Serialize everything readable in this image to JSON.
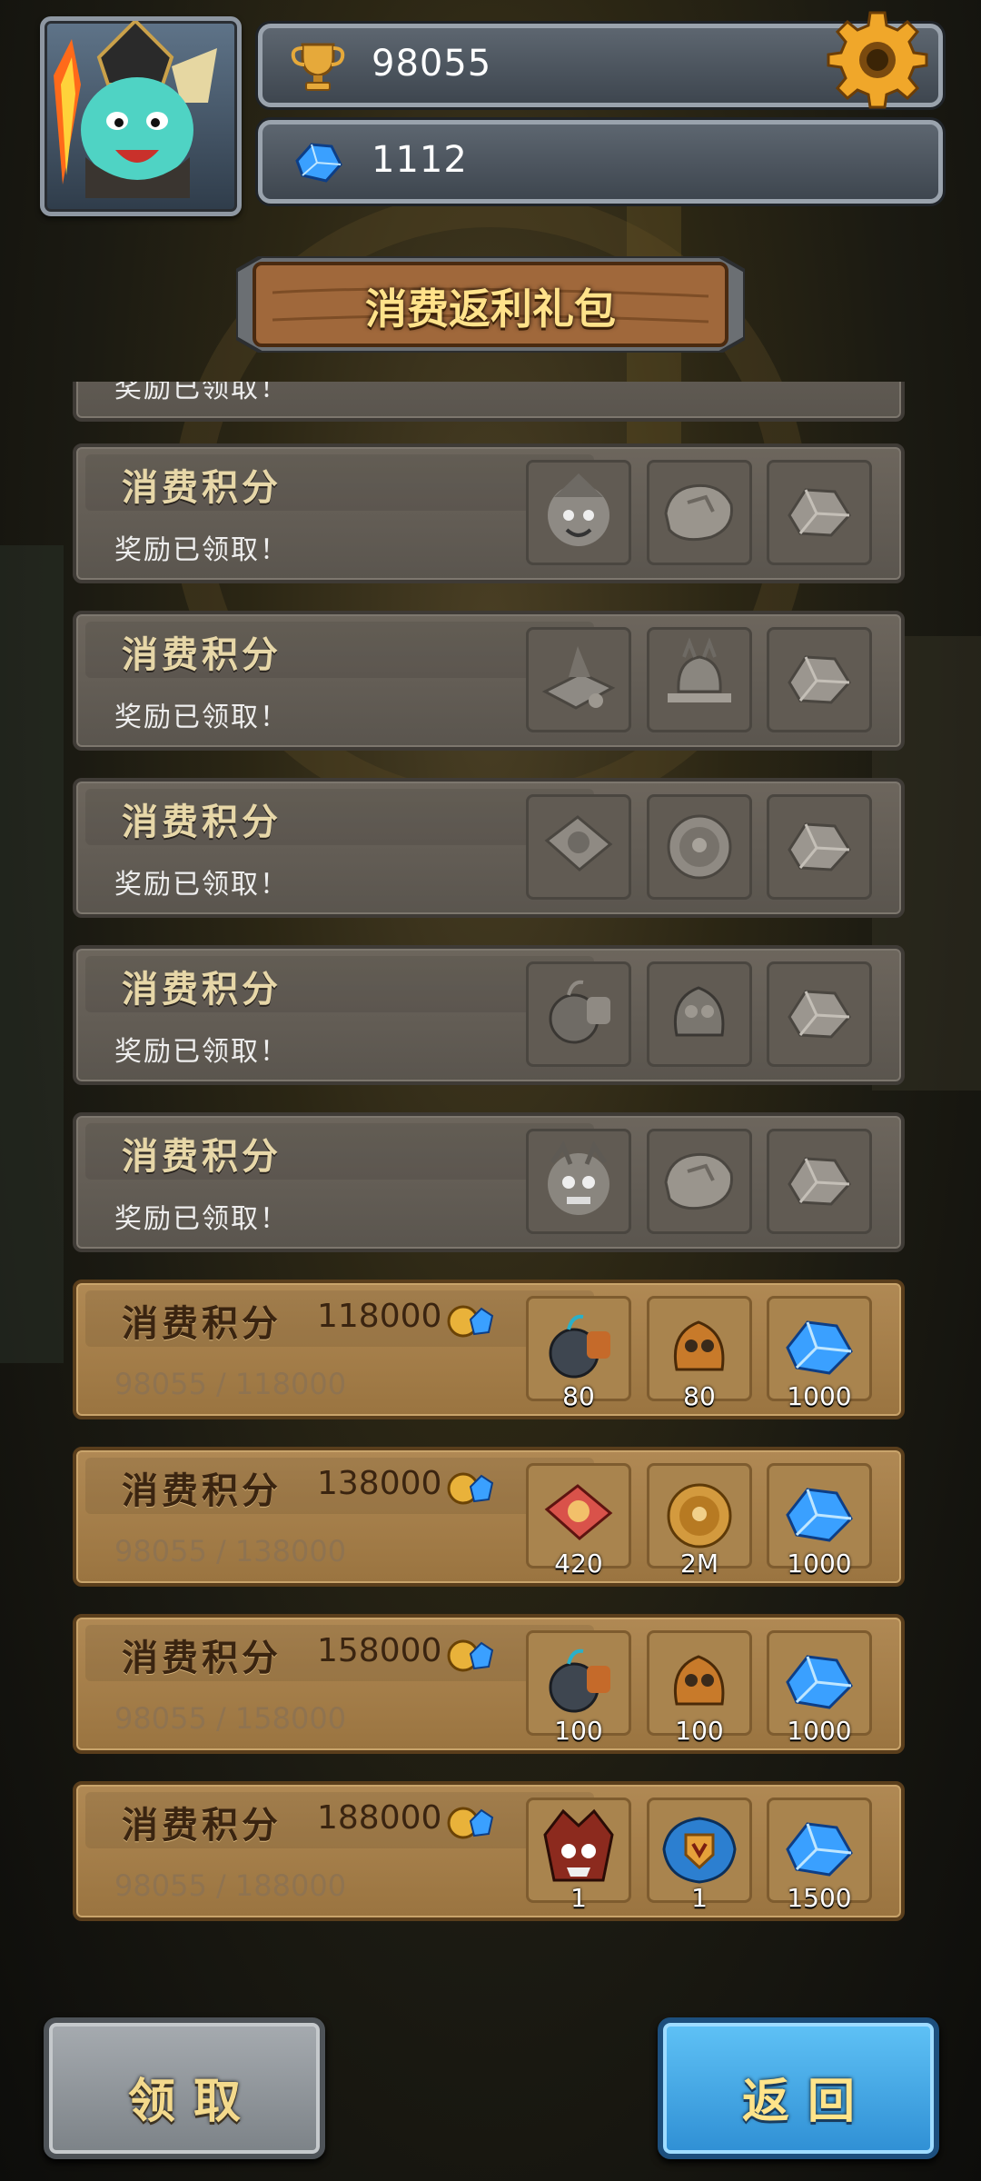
{
  "header": {
    "trophy": {
      "value": "98055",
      "icon": "trophy-icon"
    },
    "gems": {
      "value": "1112",
      "icon": "blue-gem-icon"
    },
    "settings_icon": "gear-icon",
    "avatar": "hero-avatar"
  },
  "banner": {
    "title": "消费返利礼包"
  },
  "partial_row": {
    "status": "奖励已领取！"
  },
  "rows_claimed": [
    {
      "title": "消费积分",
      "status": "奖励已领取！",
      "rewards": [
        "hero-portrait-icon",
        "ore-chunk-icon",
        "stone-icon"
      ]
    },
    {
      "title": "消费积分",
      "status": "奖励已领取！",
      "rewards": [
        "spellbook-icon",
        "knight-helmet-icon",
        "stone-icon"
      ]
    },
    {
      "title": "消费积分",
      "status": "奖励已领取！",
      "rewards": [
        "card-icon",
        "coin-icon",
        "stone-icon"
      ]
    },
    {
      "title": "消费积分",
      "status": "奖励已领取！",
      "rewards": [
        "bomb-icon",
        "armor-pack-icon",
        "stone-icon"
      ]
    },
    {
      "title": "消费积分",
      "status": "奖励已领取！",
      "rewards": [
        "beast-portrait-icon",
        "ore-chunk-icon",
        "stone-icon"
      ]
    }
  ],
  "rows_active": [
    {
      "title": "消费积分",
      "target": "118000",
      "progress": "98055 / 118000",
      "rewards": [
        {
          "icon": "bomb-icon",
          "qty": "80"
        },
        {
          "icon": "armor-pack-icon",
          "qty": "80"
        },
        {
          "icon": "blue-gem-icon",
          "qty": "1000"
        }
      ]
    },
    {
      "title": "消费积分",
      "target": "138000",
      "progress": "98055 / 138000",
      "rewards": [
        {
          "icon": "card-icon",
          "qty": "420"
        },
        {
          "icon": "coin-icon",
          "qty": "2M"
        },
        {
          "icon": "blue-gem-icon",
          "qty": "1000"
        }
      ]
    },
    {
      "title": "消费积分",
      "target": "158000",
      "progress": "98055 / 158000",
      "rewards": [
        {
          "icon": "bomb-icon",
          "qty": "100"
        },
        {
          "icon": "armor-pack-icon",
          "qty": "100"
        },
        {
          "icon": "blue-gem-icon",
          "qty": "1000"
        }
      ]
    },
    {
      "title": "消费积分",
      "target": "188000",
      "progress": "98055 / 188000",
      "rewards": [
        {
          "icon": "demon-hero-icon",
          "qty": "1"
        },
        {
          "icon": "badge-icon",
          "qty": "1"
        },
        {
          "icon": "blue-gem-icon",
          "qty": "1500"
        }
      ]
    }
  ],
  "buttons": {
    "claim": "领取",
    "back": "返回"
  },
  "colors": {
    "gold_row": "#a8824a",
    "grey_row": "#615b53",
    "back_button": "#3fa5e6",
    "title_gold": "#ffe28a"
  }
}
